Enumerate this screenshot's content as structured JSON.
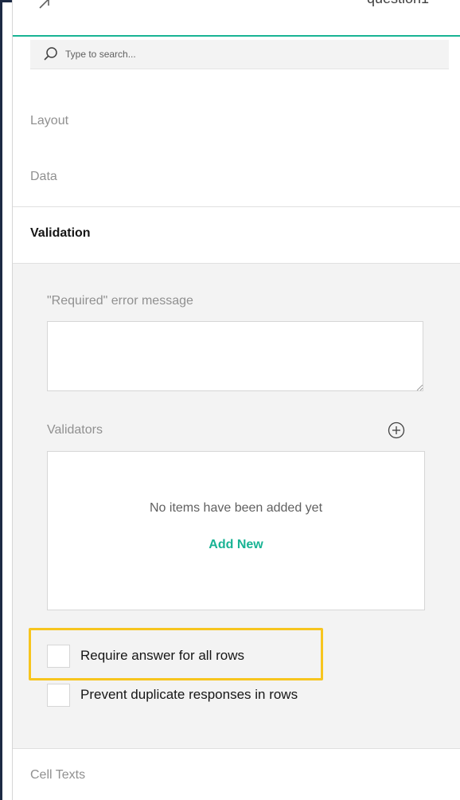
{
  "header": {
    "label": "question1"
  },
  "search": {
    "placeholder": "Type to search..."
  },
  "sections": {
    "layout": "Layout",
    "data": "Data",
    "validation": "Validation",
    "cell_texts": "Cell Texts"
  },
  "validation": {
    "required_error_label": "\"Required\" error message",
    "required_error_value": "",
    "validators_label": "Validators",
    "empty_text": "No items have been added yet",
    "add_new": "Add New",
    "require_all_rows_label": "Require answer for all rows",
    "require_all_rows_checked": false,
    "prevent_duplicates_label": "Prevent duplicate responses in rows",
    "prevent_duplicates_checked": false
  },
  "colors": {
    "accent": "#19b394",
    "highlight": "#f7c51e",
    "frame": "#1c2a44"
  }
}
